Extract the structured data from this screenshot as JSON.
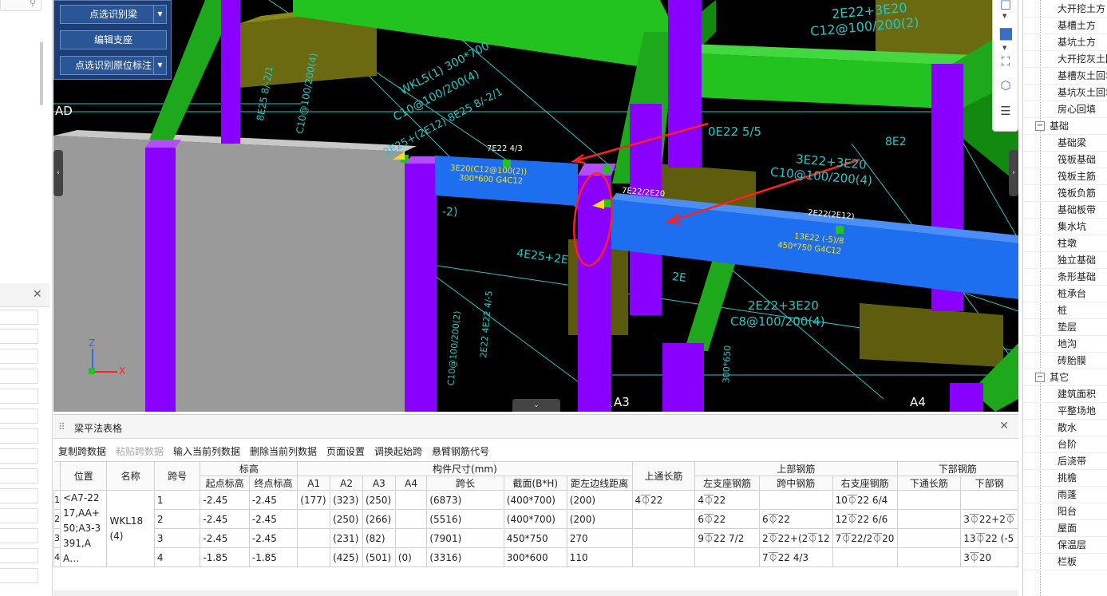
{
  "tool_panel": {
    "buttons": [
      {
        "label": "点选识别梁",
        "has_dropdown": true
      },
      {
        "label": "编辑支座",
        "has_dropdown": false
      },
      {
        "label": "点选识别原位标注",
        "has_dropdown": true
      }
    ]
  },
  "viewport": {
    "axis_labels": {
      "left": "AD",
      "a3": "A3",
      "a4": "A4"
    },
    "axis_triad": {
      "z": "Z",
      "x": "X"
    },
    "annotations": {
      "top_right_1": "2E22+3E20",
      "top_right_2": "C12@100/200(2)",
      "wkl_1": "WKL5(1) 300*700",
      "wkl_2": "C10@100/200(4)",
      "wkl_3": "2E25+(2E12) 8E25 8/-2/1",
      "left_vert_1": "8E25 8/-2/1",
      "left_vert_2": "C10@100/200(4)",
      "beam_label_1": "7E22 4/3",
      "beam_label_2": "3E20(C12@100(2))",
      "beam_label_3": "300*600 G4C12",
      "mid_1": "0E22 5/5",
      "mid_2": "3E22+3E20",
      "mid_3": "C10@100/200(4)",
      "beam_right_1": "7E22/2E20",
      "beam_right_2": "2E22(2E12)",
      "beam_right_3": "13E22 (-5)/8",
      "beam_right_4": "450*750 G4C12",
      "lower_1": "2E22+3E20",
      "lower_2": "C8@100/200(4)",
      "lower_3": "4E25+2E",
      "lower_4": "8E2",
      "lower_5": "2E",
      "lower_vert": "2E22 4E22 4/-5",
      "lower_vert_2": "C10@100/200(2)",
      "lower_vert_3": "300*650",
      "frag_1": "-2)"
    }
  },
  "view_toolbar": {
    "icons": [
      "cube-outline-icon",
      "cube-solid-icon",
      "fit-view-icon",
      "rotate-view-icon",
      "settings-list-icon"
    ]
  },
  "tree": {
    "items": [
      {
        "label": "大开挖土方",
        "type": "child"
      },
      {
        "label": "基槽土方",
        "type": "child"
      },
      {
        "label": "基坑土方",
        "type": "child"
      },
      {
        "label": "大开挖灰土回",
        "type": "child"
      },
      {
        "label": "基槽灰土回填",
        "type": "child"
      },
      {
        "label": "基坑灰土回填",
        "type": "child"
      },
      {
        "label": "房心回填",
        "type": "child"
      },
      {
        "label": "基础",
        "type": "group"
      },
      {
        "label": "基础梁",
        "type": "child"
      },
      {
        "label": "筏板基础",
        "type": "child"
      },
      {
        "label": "筏板主筋",
        "type": "child"
      },
      {
        "label": "筏板负筋",
        "type": "child"
      },
      {
        "label": "基础板带",
        "type": "child"
      },
      {
        "label": "集水坑",
        "type": "child"
      },
      {
        "label": "柱墩",
        "type": "child"
      },
      {
        "label": "独立基础",
        "type": "child"
      },
      {
        "label": "条形基础",
        "type": "child"
      },
      {
        "label": "桩承台",
        "type": "child"
      },
      {
        "label": "桩",
        "type": "child"
      },
      {
        "label": "垫层",
        "type": "child"
      },
      {
        "label": "地沟",
        "type": "child"
      },
      {
        "label": "砖胎膜",
        "type": "child"
      },
      {
        "label": "其它",
        "type": "group"
      },
      {
        "label": "建筑面积",
        "type": "child"
      },
      {
        "label": "平整场地",
        "type": "child"
      },
      {
        "label": "散水",
        "type": "child"
      },
      {
        "label": "台阶",
        "type": "child"
      },
      {
        "label": "后浇带",
        "type": "child"
      },
      {
        "label": "挑檐",
        "type": "child"
      },
      {
        "label": "雨蓬",
        "type": "child"
      },
      {
        "label": "阳台",
        "type": "child"
      },
      {
        "label": "屋面",
        "type": "child"
      },
      {
        "label": "保温层",
        "type": "child"
      },
      {
        "label": "栏板",
        "type": "child"
      }
    ],
    "collapse_symbol": "−"
  },
  "bottom_panel": {
    "title": "梁平法表格",
    "toolbar": [
      {
        "label": "复制跨数据",
        "disabled": false
      },
      {
        "label": "粘贴跨数据",
        "disabled": true
      },
      {
        "label": "输入当前列数据",
        "disabled": false
      },
      {
        "label": "删除当前列数据",
        "disabled": false
      },
      {
        "label": "页面设置",
        "disabled": false
      },
      {
        "label": "调换起始跨",
        "disabled": false
      },
      {
        "label": "悬臂钢筋代号",
        "disabled": false
      }
    ],
    "headers": {
      "position": "位置",
      "name": "名称",
      "span": "跨号",
      "elevation": "标高",
      "elev_start": "起点标高",
      "elev_end": "终点标高",
      "dims": "构件尺寸(mm)",
      "a1": "A1",
      "a2": "A2",
      "a3": "A3",
      "a4": "A4",
      "span_len": "跨长",
      "section": "截面(B*H)",
      "edge_dist": "距左边线距离",
      "top_through": "上通长筋",
      "top_rebar": "上部钢筋",
      "left_support": "左支座钢筋",
      "mid_span": "跨中钢筋",
      "right_support": "右支座钢筋",
      "bottom_rebar": "下部钢筋",
      "bottom_through": "下通长筋",
      "bottom_rebar_col": "下部钢"
    },
    "merged": {
      "position": "<A7-2217,AA+50;A3-3391,AA…",
      "name": "WKL18(4)"
    },
    "rows": [
      {
        "num": "1",
        "span": "1",
        "start": "-2.45",
        "end": "-2.45",
        "a1": "(177)",
        "a2": "(323)",
        "a3": "(250)",
        "a4": "",
        "len": "(6873)",
        "section": "(400*700)",
        "dist": "(200)",
        "top_through": "4⏁22",
        "left": "4⏁22",
        "mid": "",
        "right": "10⏁22 6/4",
        "bot_through": "",
        "bot": ""
      },
      {
        "num": "2",
        "span": "2",
        "start": "-2.45",
        "end": "-2.45",
        "a1": "",
        "a2": "(250)",
        "a3": "(266)",
        "a4": "",
        "len": "(5516)",
        "section": "(400*700)",
        "dist": "(200)",
        "top_through": "",
        "left": "6⏁22",
        "mid": "6⏁22",
        "right": "12⏁22 6/6",
        "bot_through": "",
        "bot": "3⏁22+2⏁"
      },
      {
        "num": "3",
        "span": "3",
        "start": "-2.45",
        "end": "-2.45",
        "a1": "",
        "a2": "(231)",
        "a3": "(82)",
        "a4": "",
        "len": "(7901)",
        "section": "450*750",
        "dist": "270",
        "top_through": "",
        "left": "9⏁22 7/2",
        "mid": "2⏁22+(2⏁12",
        "right": "7⏁22/2⏁20",
        "bot_through": "",
        "bot": "13⏁22 (-5"
      },
      {
        "num": "4",
        "span": "4",
        "start": "-1.85",
        "end": "-1.85",
        "a1": "",
        "a2": "(425)",
        "a3": "(501)",
        "a4": "(0)",
        "len": "(3316)",
        "section": "300*600",
        "dist": "110",
        "top_through": "",
        "left": "",
        "mid": "7⏁22 4/3",
        "right": "",
        "bot_through": "",
        "bot": "3⏁20"
      }
    ]
  },
  "colors": {
    "viewport_bg": "#000000",
    "column": "#8a00ff",
    "beam_green": "#22c21f",
    "beam_blue": "#1e6ff0",
    "slab_olive": "#6b6a10",
    "grid_cyan": "#22c8c8",
    "annotation_arrow": "#ff2020"
  }
}
